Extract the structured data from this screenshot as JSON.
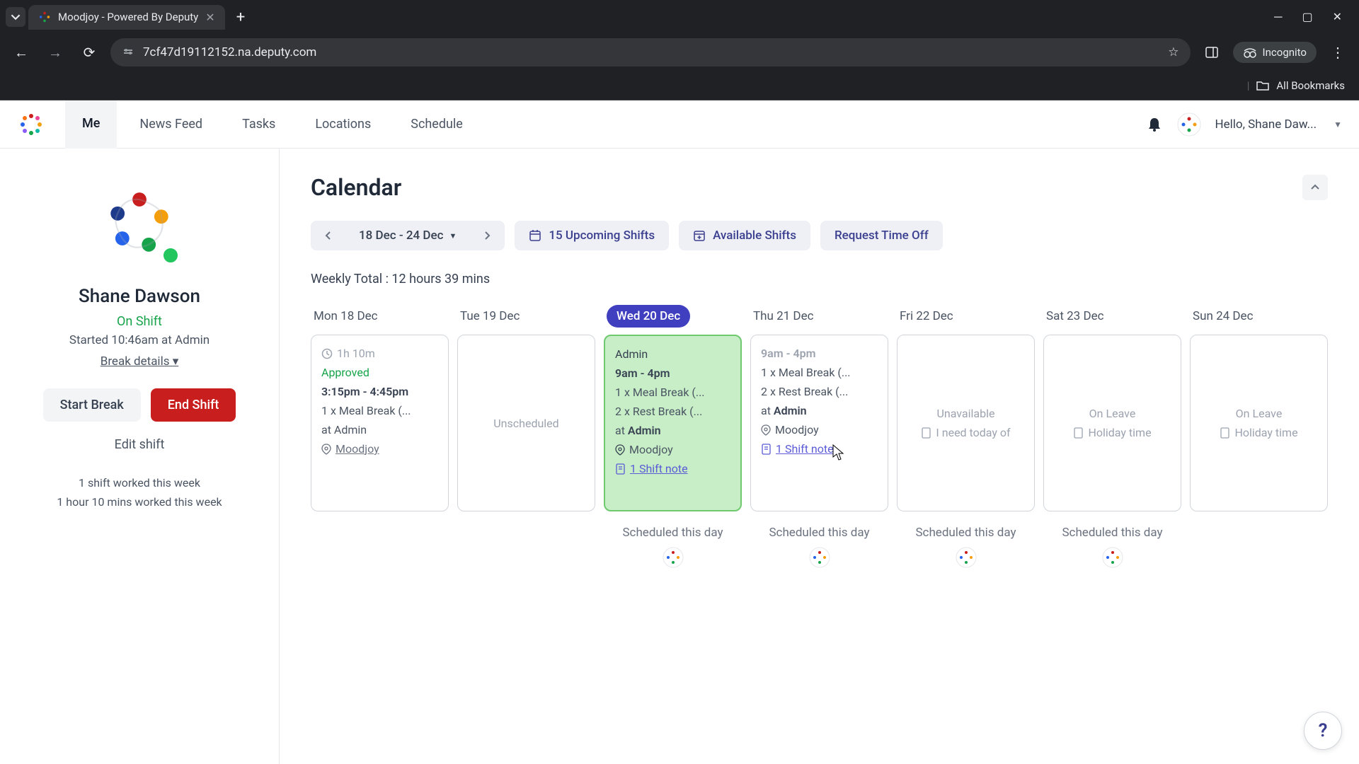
{
  "browser": {
    "tab_title": "Moodjoy - Powered By Deputy",
    "url": "7cf47d19112152.na.deputy.com",
    "incognito_label": "Incognito",
    "all_bookmarks": "All Bookmarks"
  },
  "nav": {
    "items": [
      "Me",
      "News Feed",
      "Tasks",
      "Locations",
      "Schedule"
    ],
    "greeting": "Hello, Shane Daw..."
  },
  "sidebar": {
    "name": "Shane Dawson",
    "status": "On Shift",
    "started": "Started 10:46am at Admin",
    "break_details": "Break details",
    "start_break": "Start Break",
    "end_shift": "End Shift",
    "edit_shift": "Edit shift",
    "stat1": "1 shift worked this week",
    "stat2": "1 hour 10 mins worked this week"
  },
  "calendar": {
    "title": "Calendar",
    "date_range": "18 Dec - 24 Dec",
    "upcoming": "15 Upcoming Shifts",
    "available": "Available Shifts",
    "request_off": "Request Time Off",
    "weekly_total": "Weekly Total : 12 hours 39 mins",
    "days": [
      {
        "label": "Mon 18 Dec"
      },
      {
        "label": "Tue 19 Dec"
      },
      {
        "label": "Wed 20 Dec"
      },
      {
        "label": "Thu 21 Dec"
      },
      {
        "label": "Fri 22 Dec"
      },
      {
        "label": "Sat 23 Dec"
      },
      {
        "label": "Sun 24 Dec"
      }
    ],
    "mon": {
      "duration": "1h 10m",
      "approved": "Approved",
      "time": "3:15pm - 4:45pm",
      "meal": "1 x Meal Break (...",
      "at": "at Admin",
      "loc": "Moodjoy"
    },
    "tue": {
      "text": "Unscheduled"
    },
    "wed": {
      "role": "Admin",
      "time": "9am - 4pm",
      "meal": "1 x Meal Break (...",
      "rest": "2 x Rest Break (...",
      "at_prefix": "at ",
      "at_role": "Admin",
      "loc": "Moodjoy",
      "note": "1 Shift note"
    },
    "thu": {
      "time": "9am - 4pm",
      "meal": "1 x Meal Break (...",
      "rest": "2 x Rest Break (...",
      "at_prefix": "at ",
      "at_role": "Admin",
      "loc": "Moodjoy",
      "note": "1 Shift note"
    },
    "fri": {
      "status": "Unavailable",
      "reason": "I need today of"
    },
    "sat": {
      "status": "On Leave",
      "reason": "Holiday time"
    },
    "sun": {
      "status": "On Leave",
      "reason": "Holiday time"
    },
    "scheduled_label": "Scheduled this day"
  }
}
